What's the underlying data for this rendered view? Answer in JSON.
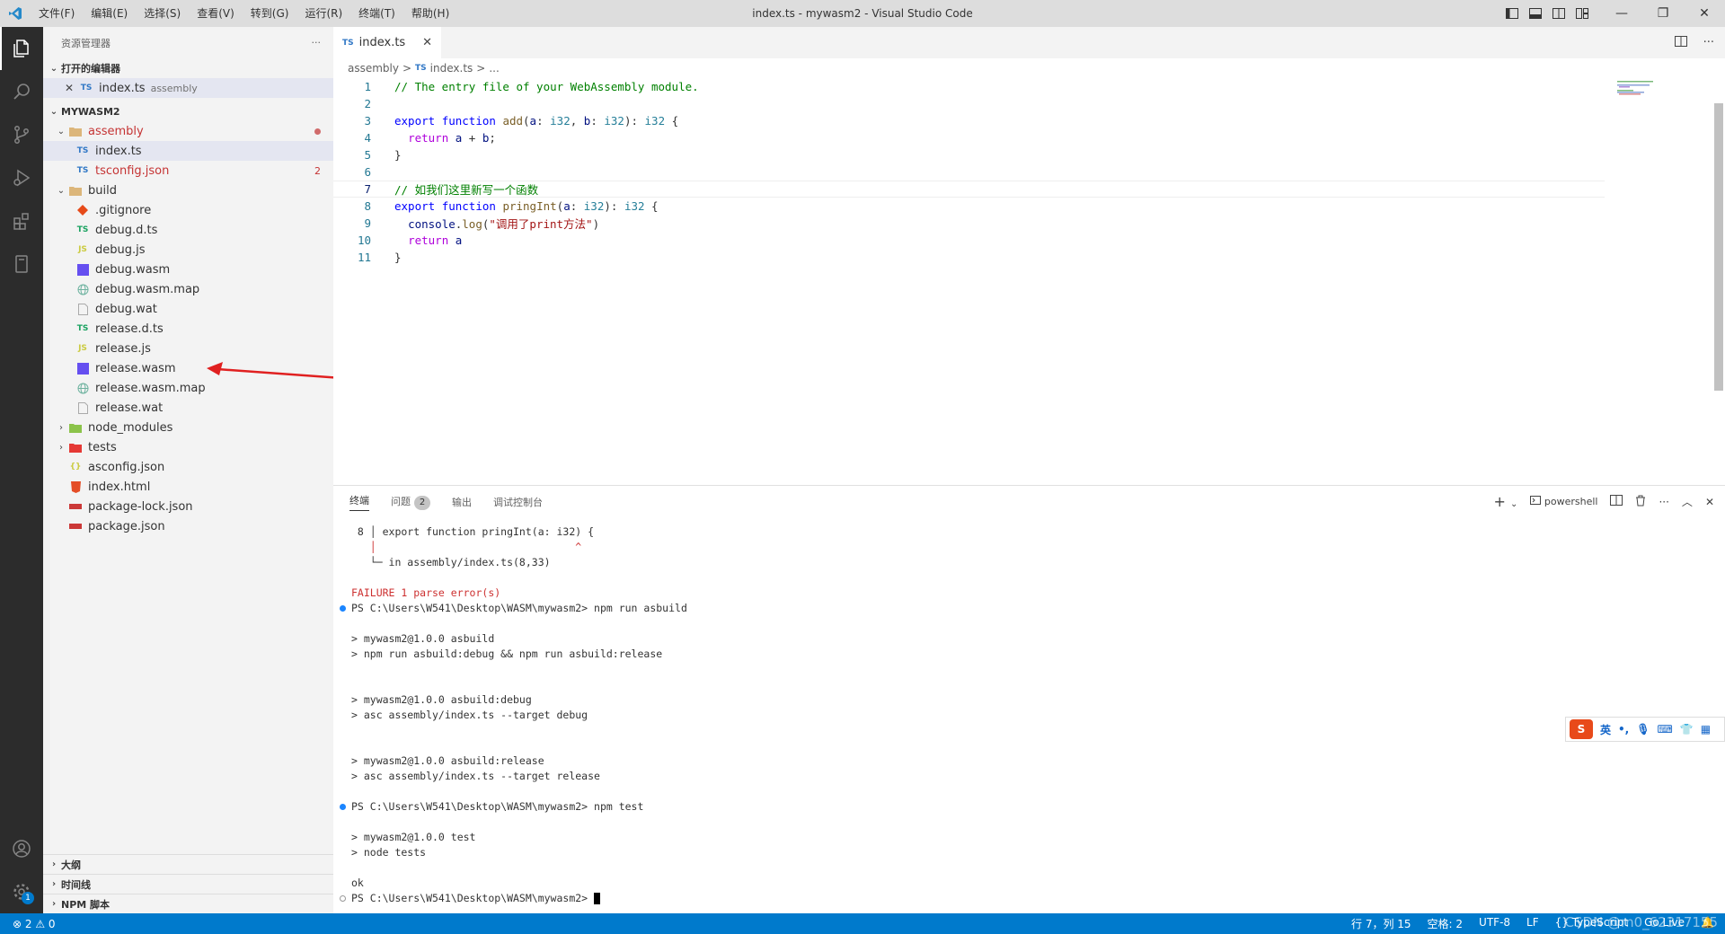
{
  "titlebar": {
    "menu": [
      "文件(F)",
      "编辑(E)",
      "选择(S)",
      "查看(V)",
      "转到(G)",
      "运行(R)",
      "终端(T)",
      "帮助(H)"
    ],
    "title": "index.ts - mywasm2 - Visual Studio Code",
    "minimize": "—",
    "restore": "❐",
    "close": "✕"
  },
  "sidebar": {
    "title": "资源管理器",
    "more": "···",
    "open_editors_title": "打开的编辑器",
    "open_editor": {
      "name": "index.ts",
      "folder": "assembly"
    },
    "project_title": "MYWASM2",
    "tree": [
      {
        "name": "assembly",
        "type": "folder"
      },
      {
        "name": "index.ts",
        "type": "ts"
      },
      {
        "name": "tsconfig.json",
        "type": "ts",
        "errors": "2"
      },
      {
        "name": "build",
        "type": "folder"
      },
      {
        "name": ".gitignore",
        "type": "git"
      },
      {
        "name": "debug.d.ts",
        "type": "ts"
      },
      {
        "name": "debug.js",
        "type": "js"
      },
      {
        "name": "debug.wasm",
        "type": "wasm"
      },
      {
        "name": "debug.wasm.map",
        "type": "map"
      },
      {
        "name": "debug.wat",
        "type": "file"
      },
      {
        "name": "release.d.ts",
        "type": "ts"
      },
      {
        "name": "release.js",
        "type": "js"
      },
      {
        "name": "release.wasm",
        "type": "wasm"
      },
      {
        "name": "release.wasm.map",
        "type": "map"
      },
      {
        "name": "release.wat",
        "type": "file"
      },
      {
        "name": "node_modules",
        "type": "folder"
      },
      {
        "name": "tests",
        "type": "folder"
      },
      {
        "name": "asconfig.json",
        "type": "json"
      },
      {
        "name": "index.html",
        "type": "html"
      },
      {
        "name": "package-lock.json",
        "type": "npm"
      },
      {
        "name": "package.json",
        "type": "npm"
      }
    ],
    "outline": "大纲",
    "timeline": "时间线",
    "npm_scripts": "NPM 脚本"
  },
  "editor": {
    "tab_label": "index.ts",
    "tab_badge": "TS",
    "crumbs": [
      "assembly",
      ">",
      "TS",
      "index.ts",
      ">",
      "..."
    ],
    "line_numbers": [
      "1",
      "2",
      "3",
      "4",
      "5",
      "6",
      "7",
      "8",
      "9",
      "10",
      "11"
    ]
  },
  "panel": {
    "tabs": [
      "终端",
      "问题",
      "输出",
      "调试控制台"
    ],
    "problems_count": "2",
    "shell": "powershell",
    "terminal": [
      " 8 │ export function pringInt(a: i32) {",
      "   │                                ^",
      "   └─ in assembly/index.ts(8,33)",
      "",
      "FAILURE 1 parse error(s)",
      "PS C:\\Users\\W541\\Desktop\\WASM\\mywasm2> npm run asbuild",
      "",
      "> mywasm2@1.0.0 asbuild",
      "> npm run asbuild:debug && npm run asbuild:release",
      "",
      "",
      "> mywasm2@1.0.0 asbuild:debug",
      "> asc assembly/index.ts --target debug",
      "",
      "",
      "> mywasm2@1.0.0 asbuild:release",
      "> asc assembly/index.ts --target release",
      "",
      "PS C:\\Users\\W541\\Desktop\\WASM\\mywasm2> npm test",
      "",
      "> mywasm2@1.0.0 test",
      "> node tests",
      "",
      "ok",
      "PS C:\\Users\\W541\\Desktop\\WASM\\mywasm2> "
    ]
  },
  "ime": {
    "logo": "S",
    "lang": "英"
  },
  "status": {
    "problems": "⊗ 2 ⚠ 0",
    "cursor_pos": "行 7，列 15",
    "spaces": "空格: 2",
    "encoding": "UTF-8",
    "eol": "LF",
    "language": "{} TypeScript",
    "golive": "Go Live",
    "watermark": "CSDN @m0_62317155"
  },
  "colors": {
    "accent": "#007acc",
    "activity_bar": "#2c2c2c",
    "sidebar": "#f3f3f3",
    "arrow": "#e02020"
  }
}
